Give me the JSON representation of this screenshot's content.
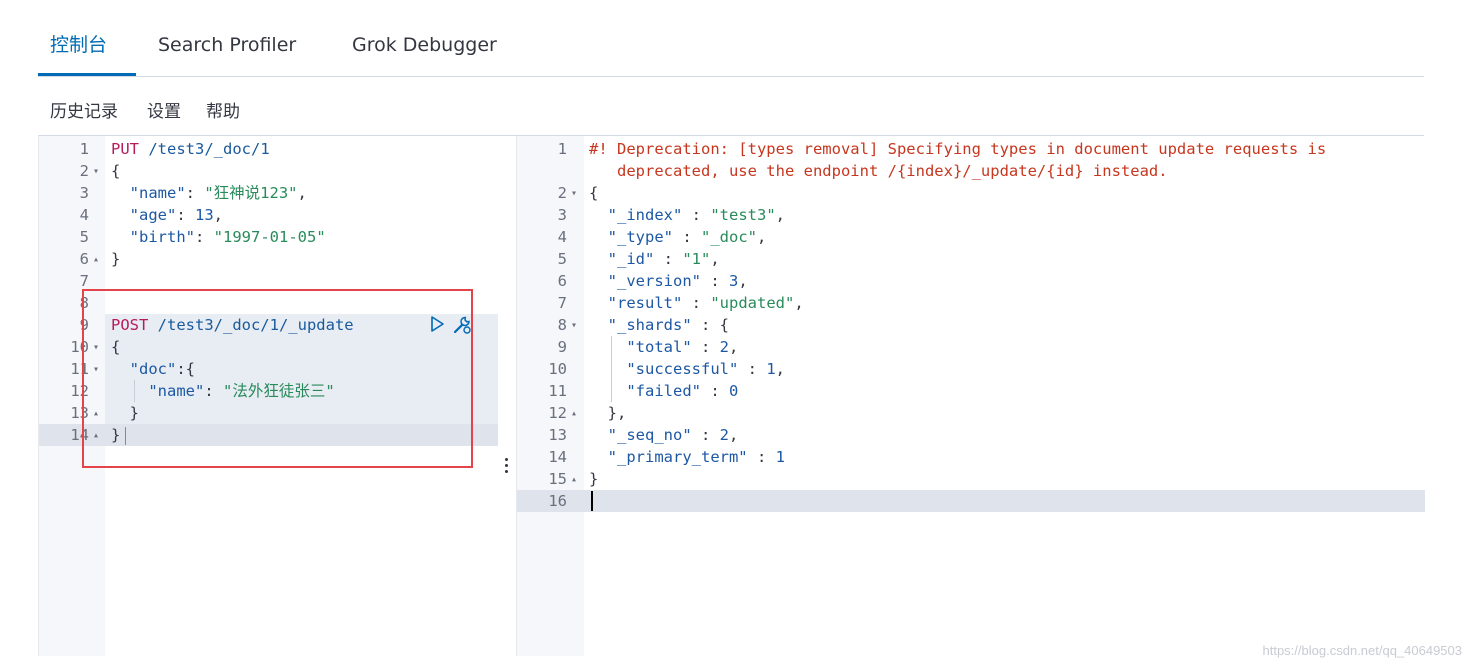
{
  "tabs": [
    {
      "label": "控制台",
      "active": true
    },
    {
      "label": "Search Profiler",
      "active": false
    },
    {
      "label": "Grok Debugger",
      "active": false
    }
  ],
  "submenu": {
    "history": "历史记录",
    "settings": "设置",
    "help": "帮助"
  },
  "request_lines": [
    {
      "n": "1",
      "fold": "",
      "parts": [
        [
          "method",
          "PUT"
        ],
        [
          "url",
          " /test3/_doc/1"
        ]
      ]
    },
    {
      "n": "2",
      "fold": "▾",
      "parts": [
        [
          "punc",
          "{"
        ]
      ]
    },
    {
      "n": "3",
      "fold": "",
      "parts": [
        [
          "key",
          "  \"name\""
        ],
        [
          "punc",
          ": "
        ],
        [
          "str",
          "\"狂神说123\""
        ],
        [
          "punc",
          ","
        ]
      ]
    },
    {
      "n": "4",
      "fold": "",
      "parts": [
        [
          "key",
          "  \"age\""
        ],
        [
          "punc",
          ": "
        ],
        [
          "num",
          "13"
        ],
        [
          "punc",
          ","
        ]
      ]
    },
    {
      "n": "5",
      "fold": "",
      "parts": [
        [
          "key",
          "  \"birth\""
        ],
        [
          "punc",
          ": "
        ],
        [
          "str",
          "\"1997-01-05\""
        ]
      ]
    },
    {
      "n": "6",
      "fold": "▴",
      "parts": [
        [
          "punc",
          "}"
        ]
      ]
    },
    {
      "n": "7",
      "fold": "",
      "parts": []
    },
    {
      "n": "8",
      "fold": "",
      "parts": []
    },
    {
      "n": "9",
      "fold": "",
      "parts": [
        [
          "method",
          "POST"
        ],
        [
          "url",
          " /test3/_doc/1/_update"
        ]
      ]
    },
    {
      "n": "10",
      "fold": "▾",
      "parts": [
        [
          "punc",
          "{"
        ]
      ]
    },
    {
      "n": "11",
      "fold": "▾",
      "parts": [
        [
          "key",
          "  \"doc\""
        ],
        [
          "punc",
          ":{"
        ]
      ]
    },
    {
      "n": "12",
      "fold": "",
      "parts": [
        [
          "key",
          "    \"name\""
        ],
        [
          "punc",
          ": "
        ],
        [
          "str",
          "\"法外狂徒张三\""
        ]
      ]
    },
    {
      "n": "13",
      "fold": "▴",
      "parts": [
        [
          "punc",
          "  }"
        ]
      ]
    },
    {
      "n": "14",
      "fold": "▴",
      "parts": [
        [
          "punc",
          "}"
        ]
      ]
    }
  ],
  "response_lines": [
    {
      "n": "1",
      "fold": "",
      "parts": [
        [
          "warn",
          "#! Deprecation: [types removal] Specifying types in document update requests is"
        ]
      ]
    },
    {
      "n": "",
      "fold": "",
      "parts": [
        [
          "warn",
          "   deprecated, use the endpoint /{index}/_update/{id} instead."
        ]
      ]
    },
    {
      "n": "2",
      "fold": "▾",
      "parts": [
        [
          "punc",
          "{"
        ]
      ]
    },
    {
      "n": "3",
      "fold": "",
      "parts": [
        [
          "key",
          "  \"_index\""
        ],
        [
          "punc",
          " : "
        ],
        [
          "str",
          "\"test3\""
        ],
        [
          "punc",
          ","
        ]
      ]
    },
    {
      "n": "4",
      "fold": "",
      "parts": [
        [
          "key",
          "  \"_type\""
        ],
        [
          "punc",
          " : "
        ],
        [
          "str",
          "\"_doc\""
        ],
        [
          "punc",
          ","
        ]
      ]
    },
    {
      "n": "5",
      "fold": "",
      "parts": [
        [
          "key",
          "  \"_id\""
        ],
        [
          "punc",
          " : "
        ],
        [
          "str",
          "\"1\""
        ],
        [
          "punc",
          ","
        ]
      ]
    },
    {
      "n": "6",
      "fold": "",
      "parts": [
        [
          "key",
          "  \"_version\""
        ],
        [
          "punc",
          " : "
        ],
        [
          "num",
          "3"
        ],
        [
          "punc",
          ","
        ]
      ]
    },
    {
      "n": "7",
      "fold": "",
      "parts": [
        [
          "key",
          "  \"result\""
        ],
        [
          "punc",
          " : "
        ],
        [
          "str",
          "\"updated\""
        ],
        [
          "punc",
          ","
        ]
      ]
    },
    {
      "n": "8",
      "fold": "▾",
      "parts": [
        [
          "key",
          "  \"_shards\""
        ],
        [
          "punc",
          " : {"
        ]
      ]
    },
    {
      "n": "9",
      "fold": "",
      "parts": [
        [
          "key",
          "    \"total\""
        ],
        [
          "punc",
          " : "
        ],
        [
          "num",
          "2"
        ],
        [
          "punc",
          ","
        ]
      ]
    },
    {
      "n": "10",
      "fold": "",
      "parts": [
        [
          "key",
          "    \"successful\""
        ],
        [
          "punc",
          " : "
        ],
        [
          "num",
          "1"
        ],
        [
          "punc",
          ","
        ]
      ]
    },
    {
      "n": "11",
      "fold": "",
      "parts": [
        [
          "key",
          "    \"failed\""
        ],
        [
          "punc",
          " : "
        ],
        [
          "num",
          "0"
        ]
      ]
    },
    {
      "n": "12",
      "fold": "▴",
      "parts": [
        [
          "punc",
          "  },"
        ]
      ]
    },
    {
      "n": "13",
      "fold": "",
      "parts": [
        [
          "key",
          "  \"_seq_no\""
        ],
        [
          "punc",
          " : "
        ],
        [
          "num",
          "2"
        ],
        [
          "punc",
          ","
        ]
      ]
    },
    {
      "n": "14",
      "fold": "",
      "parts": [
        [
          "key",
          "  \"_primary_term\""
        ],
        [
          "punc",
          " : "
        ],
        [
          "num",
          "1"
        ]
      ]
    },
    {
      "n": "15",
      "fold": "▴",
      "parts": [
        [
          "punc",
          "}"
        ]
      ]
    },
    {
      "n": "16",
      "fold": "",
      "parts": []
    }
  ],
  "icons": {
    "run": "play-icon",
    "settings": "wrench-icon"
  },
  "colors": {
    "accent": "#006bb4",
    "method": "#b71c5a",
    "string": "#298b5b",
    "warning": "#c7361f",
    "highlight_box": "#e4434a"
  },
  "watermark": "https://blog.csdn.net/qq_40649503"
}
